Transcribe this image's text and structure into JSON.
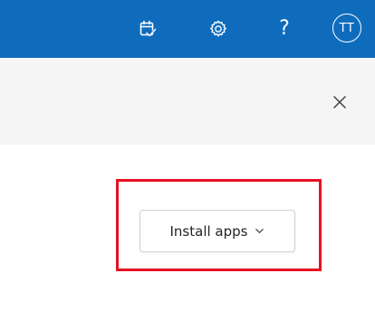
{
  "topbar": {
    "background": "#0f6cbd",
    "icons": [
      {
        "name": "calendar-check-icon"
      },
      {
        "name": "gear-icon"
      },
      {
        "name": "help-icon",
        "glyph": "?"
      }
    ],
    "avatar_initials": "TT"
  },
  "panel": {
    "close_icon": "close-icon",
    "install_button_label": "Install apps",
    "install_button_icon": "chevron-down-icon"
  },
  "colors": {
    "header_bg": "#f5f5f5",
    "highlight": "#e81123"
  }
}
